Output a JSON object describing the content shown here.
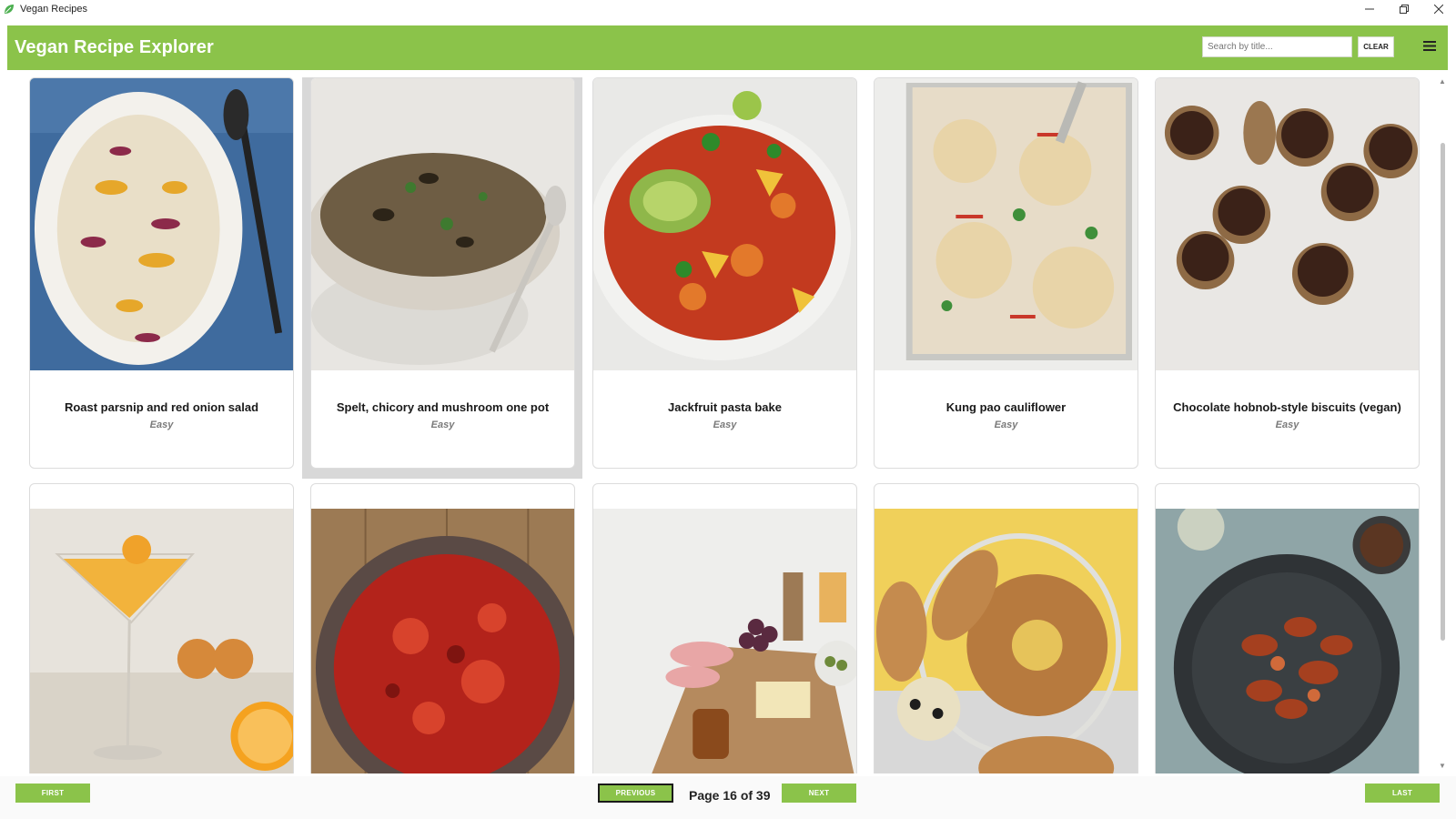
{
  "window": {
    "title": "Vegan Recipes",
    "controls": [
      "minimize",
      "restore",
      "close"
    ]
  },
  "header": {
    "app_title": "Vegan Recipe Explorer",
    "search_placeholder": "Search by title...",
    "clear_label": "CLEAR",
    "accent_color": "#8bc34a"
  },
  "recipes": [
    {
      "name": "Roast parsnip and red onion salad",
      "difficulty": "Easy",
      "image": "parsnip-salad-photo"
    },
    {
      "name": "Spelt, chicory and mushroom one pot",
      "difficulty": "Easy",
      "image": "spelt-one-pot-photo"
    },
    {
      "name": "Jackfruit pasta bake",
      "difficulty": "Easy",
      "image": "pasta-bake-photo"
    },
    {
      "name": "Kung pao cauliflower",
      "difficulty": "Easy",
      "image": "cauliflower-tray-photo"
    },
    {
      "name": "Chocolate hobnob-style biscuits (vegan)",
      "difficulty": "Easy",
      "image": "chocolate-biscuits-photo"
    },
    {
      "image": "orange-cocktail-photo"
    },
    {
      "image": "tomato-stew-photo"
    },
    {
      "image": "charcuterie-board-photo"
    },
    {
      "image": "sesame-bagels-photo"
    },
    {
      "image": "spiced-prawns-photo"
    }
  ],
  "pagination": {
    "first_label": "FIRST",
    "previous_label": "PREVIOUS",
    "next_label": "NEXT",
    "last_label": "LAST",
    "page_text": "Page 16 of 39",
    "current_page": 16,
    "total_pages": 39
  }
}
